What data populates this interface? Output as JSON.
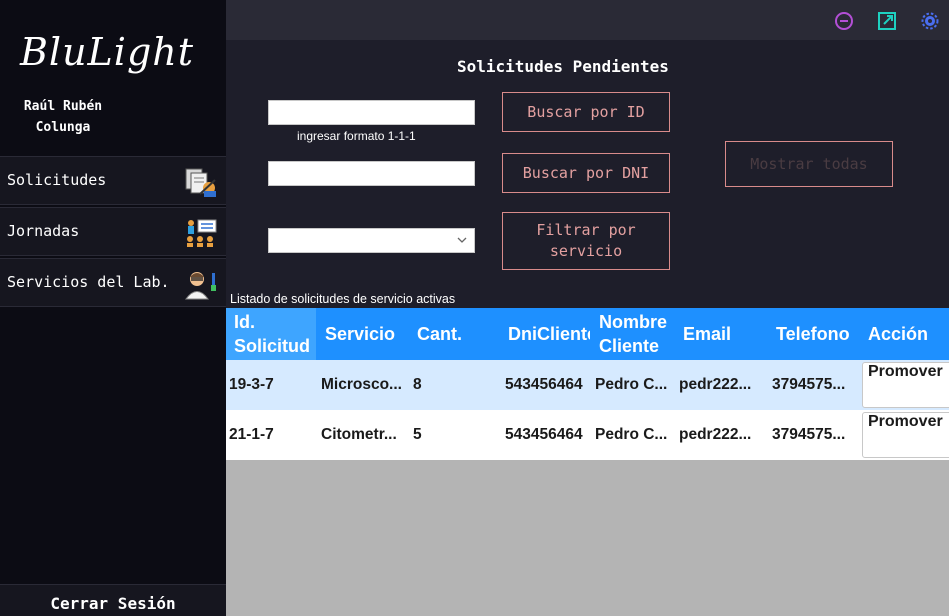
{
  "sidebar": {
    "logo": "BluLight",
    "user_name": "Raúl Rubén Colunga",
    "items": [
      {
        "label": "Solicitudes",
        "icon": "documents-icon"
      },
      {
        "label": "Jornadas",
        "icon": "presentation-icon"
      },
      {
        "label": "Servicios del Lab.",
        "icon": "scientist-icon"
      }
    ],
    "logout_label": "Cerrar Sesión"
  },
  "topbar": {
    "icons": [
      "minimize-icon",
      "external-link-icon",
      "settings-icon"
    ],
    "colors": {
      "minimize": "#b34fd6",
      "external": "#1ed0c0",
      "settings": "#4a6ef0"
    }
  },
  "main": {
    "title": "Solicitudes Pendientes",
    "id_input": {
      "value": "",
      "placeholder": ""
    },
    "id_hint": "ingresar formato 1-1-1",
    "dni_input": {
      "value": "",
      "placeholder": ""
    },
    "service_select": {
      "value": ""
    },
    "buttons": {
      "search_id": "Buscar por ID",
      "search_dni": "Buscar por DNI",
      "filter_service": "Filtrar por servicio",
      "show_all": "Mostrar todas"
    },
    "list_label": "Listado de solicitudes de servicio activas"
  },
  "table": {
    "columns": [
      "Id. Solicitud",
      "Servicio",
      "Cant.",
      "DniCliente",
      "Nombre Cliente",
      "Email",
      "Telefono",
      "Acción"
    ],
    "rows": [
      {
        "id": "19-3-7",
        "servicio": "Microsco...",
        "cant": "8",
        "dni": "543456464",
        "nombre": "Pedro C...",
        "email": "pedr222...",
        "telefono": "3794575...",
        "accion": "Promover"
      },
      {
        "id": "21-1-7",
        "servicio": "Citometr...",
        "cant": "5",
        "dni": "543456464",
        "nombre": "Pedro C...",
        "email": "pedr222...",
        "telefono": "3794575...",
        "accion": "Promover"
      }
    ]
  },
  "colors": {
    "accent_blue": "#1e90ff",
    "button_border": "#d98b8b",
    "background": "#1e1e2a",
    "sidebar": "#0c0c14"
  }
}
